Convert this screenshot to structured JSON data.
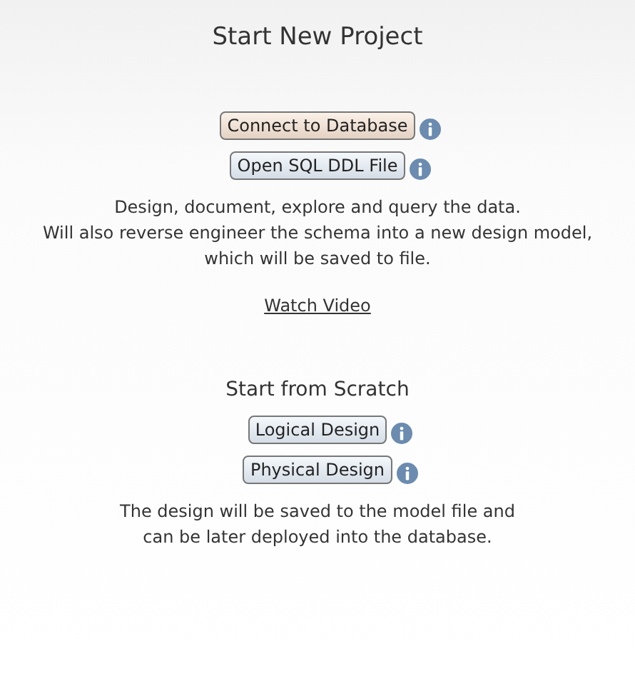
{
  "title": "Start New Project",
  "sections": [
    {
      "buttons": [
        {
          "label": "Connect to Database",
          "highlighted": true
        },
        {
          "label": "Open SQL DDL File",
          "highlighted": false
        }
      ],
      "description": [
        "Design, document, explore and query the data.",
        "Will also reverse engineer the schema into a new design model,",
        "which will be saved to file."
      ],
      "link": "Watch Video"
    },
    {
      "heading": "Start from Scratch",
      "buttons": [
        {
          "label": "Logical Design",
          "highlighted": false
        },
        {
          "label": "Physical Design",
          "highlighted": false
        }
      ],
      "description": [
        "The design will be saved to the model file and",
        "can be later deployed into the database."
      ]
    }
  ]
}
